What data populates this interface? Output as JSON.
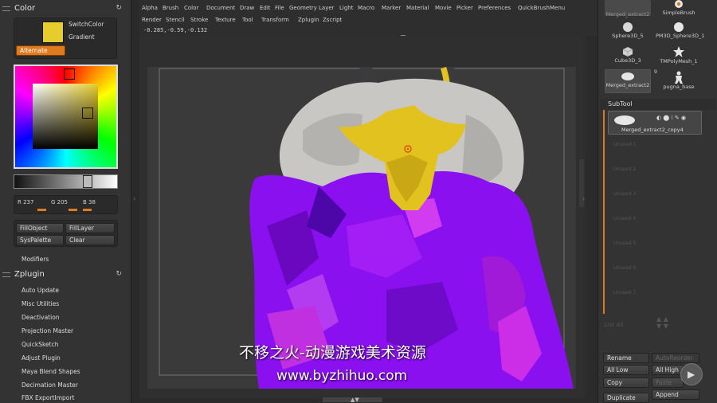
{
  "color_panel": {
    "title": "Color",
    "switch_color": "SwitchColor",
    "gradient": "Gradient",
    "alternate": "Alternate",
    "main_color": "#e6cd2e",
    "r_label": "R 237",
    "g_label": "G 205",
    "b_label": "B 38",
    "fill_object": "FillObject",
    "fill_layer": "FillLayer",
    "syspalette": "SysPalette",
    "clear": "Clear",
    "modifiers": "Modifiers"
  },
  "zplugin": {
    "title": "Zplugin",
    "items": [
      "Auto Update",
      "Misc Utilities",
      "Deactivation",
      "Projection Master",
      "QuickSketch",
      "Adjust Plugin",
      "Maya Blend Shapes",
      "Decimation Master",
      "FBX ExportImport"
    ]
  },
  "menubar": {
    "row1": [
      "Alpha",
      "Brush",
      "Color",
      "Document",
      "Draw",
      "Edit",
      "File",
      "Geometry",
      "Layer",
      "Light",
      "Macro",
      "Marker",
      "Material",
      "Movie",
      "Picker",
      "Preferences",
      "QuickBrushMenu"
    ],
    "row2": [
      "Render",
      "Stencil",
      "Stroke",
      "Texture",
      "Tool",
      "Transform",
      "Zplugin",
      "Zscript"
    ],
    "coords": "-0.285,-0.59,-0.132"
  },
  "tool_palette": {
    "current": "Merged_extract2",
    "items": [
      "SimpleBrush",
      "Sphere3D_5",
      "PM3D_Sphere3D_1",
      "Cube3D_3",
      "TMPolyMesh_1",
      "Merged_extract2",
      "pugna_base"
    ],
    "count": "9"
  },
  "subtool": {
    "title": "SubTool",
    "active": "Merged_extract2_copy4",
    "slots": [
      "Unused 1",
      "Unused 2",
      "Unused 3",
      "Unused 4",
      "Unused 5",
      "Unused 6",
      "Unused 7"
    ],
    "list_all": "List All",
    "rename": "Rename",
    "auto_reorder": "AutoReorder",
    "all_low": "All Low",
    "all_high": "All High",
    "copy": "Copy",
    "paste": "Paste",
    "append": "Append",
    "duplicate": "Duplicate"
  },
  "watermark": {
    "line1": "不移之火-动漫游戏美术资源",
    "line2": "www.byzhihuo.com"
  },
  "colors": {
    "accent_orange": "#e07a1f",
    "model_purple": "#8a10f0",
    "model_yellow": "#e2c21e",
    "model_grey": "#c9c7c4"
  }
}
